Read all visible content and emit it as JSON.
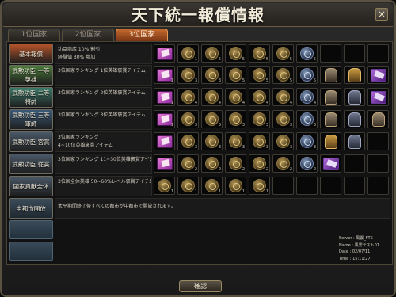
{
  "window": {
    "title": "天下統一報償情報",
    "close_label": "×"
  },
  "tabs": [
    {
      "label": "1位国家",
      "active": false
    },
    {
      "label": "2位国家",
      "active": false
    },
    {
      "label": "3位国家",
      "active": true
    }
  ],
  "rows": [
    {
      "button": "基本報償",
      "button_color": "#b4542a",
      "desc": [
        "功臣商店 10% 割引",
        "経験値 30% 増加"
      ],
      "slots": [
        {
          "icon": "book-icon",
          "count": ""
        },
        {
          "icon": "coin-icon",
          "count": "1"
        },
        {
          "icon": "coin-icon",
          "count": "5"
        },
        {
          "icon": "coin-icon",
          "count": "5"
        },
        {
          "icon": "coin-icon",
          "count": "5"
        },
        {
          "icon": "coin-icon",
          "count": "5"
        },
        {
          "icon": "blue-coin-icon",
          "count": "5"
        }
      ]
    },
    {
      "button": "武勲功臣 一等英雄",
      "button_color": "#4a7a3a",
      "desc": [
        "3位国家ランキング 1位英雄褒賞アイテム"
      ],
      "slots": [
        {
          "icon": "book-icon",
          "count": "1"
        },
        {
          "icon": "coin-icon",
          "count": "3"
        },
        {
          "icon": "coin-icon",
          "count": "3"
        },
        {
          "icon": "coin-icon",
          "count": "5"
        },
        {
          "icon": "coin-icon",
          "count": "5"
        },
        {
          "icon": "coin-icon",
          "count": "5"
        },
        {
          "icon": "blue-coin-icon",
          "count": "5"
        },
        {
          "icon": "armor-icon",
          "count": ""
        },
        {
          "icon": "gold-armor-icon",
          "count": ""
        },
        {
          "icon": "scroll-icon",
          "count": ""
        },
        {
          "icon": "red-helm-icon",
          "count": ""
        }
      ]
    },
    {
      "button": "武勲功臣 二等将帥",
      "button_color": "#3a7a6a",
      "desc": [
        "3位国家ランキング 2位英雄褒賞アイテム"
      ],
      "slots": [
        {
          "icon": "book-icon",
          "count": "1"
        },
        {
          "icon": "coin-icon",
          "count": "4"
        },
        {
          "icon": "coin-icon",
          "count": "4"
        },
        {
          "icon": "coin-icon",
          "count": "4"
        },
        {
          "icon": "coin-icon",
          "count": "4"
        },
        {
          "icon": "coin-icon",
          "count": "4"
        },
        {
          "icon": "blue-coin-icon",
          "count": "4"
        },
        {
          "icon": "armor-icon",
          "count": ""
        },
        {
          "icon": "dark-armor-icon",
          "count": ""
        },
        {
          "icon": "scroll-icon",
          "count": ""
        },
        {
          "icon": "horse-icon",
          "count": ""
        },
        {
          "icon": "dark-helm-icon",
          "count": ""
        }
      ]
    },
    {
      "button": "武勲功臣 三等軍師",
      "button_color": "#3a5a7a",
      "desc": [
        "3位国家ランキング 3位英雄褒賞アイテム"
      ],
      "slots": [
        {
          "icon": "book-icon",
          "count": "1"
        },
        {
          "icon": "coin-icon",
          "count": "3"
        },
        {
          "icon": "coin-icon",
          "count": "3"
        },
        {
          "icon": "coin-icon",
          "count": "3"
        },
        {
          "icon": "coin-icon",
          "count": "3"
        },
        {
          "icon": "coin-icon",
          "count": "3"
        },
        {
          "icon": "blue-coin-icon",
          "count": "3"
        },
        {
          "icon": "armor-icon",
          "count": ""
        },
        {
          "icon": "dark-armor-icon",
          "count": ""
        },
        {
          "icon": "armor-icon",
          "count": ""
        },
        {
          "icon": "scroll-icon",
          "count": ""
        },
        {
          "icon": "dark-helm-icon",
          "count": "11"
        }
      ]
    },
    {
      "button": "武勲功臣 宮賞",
      "button_color": "#4a5868",
      "desc": [
        "3位国家ランキング",
        "4~10位英雄褒賞アイテム"
      ],
      "slots": [
        {
          "icon": "book-icon",
          "count": ""
        },
        {
          "icon": "coin-icon",
          "count": "3"
        },
        {
          "icon": "coin-icon",
          "count": "3"
        },
        {
          "icon": "coin-icon",
          "count": "3"
        },
        {
          "icon": "coin-icon",
          "count": "3"
        },
        {
          "icon": "coin-icon",
          "count": "3"
        },
        {
          "icon": "blue-coin-icon",
          "count": "3"
        },
        {
          "icon": "gold-armor-icon",
          "count": ""
        },
        {
          "icon": "dark-armor-icon",
          "count": ""
        }
      ]
    },
    {
      "button": "武勲功臣 従賞",
      "button_color": "#4a5868",
      "desc": [
        "3位国家ランキング 11~30位英雄褒賞アイテ"
      ],
      "slots": [
        {
          "icon": "book-icon",
          "count": ""
        },
        {
          "icon": "coin-icon",
          "count": "2"
        },
        {
          "icon": "coin-icon",
          "count": "2"
        },
        {
          "icon": "coin-icon",
          "count": "2"
        },
        {
          "icon": "coin-icon",
          "count": "2"
        },
        {
          "icon": "coin-icon",
          "count": "2"
        },
        {
          "icon": "blue-coin-icon",
          "count": "2"
        },
        {
          "icon": "scroll-icon",
          "count": ""
        }
      ]
    },
    {
      "button": "国家貢献全体",
      "button_color": "#4a5868",
      "desc": [
        "3位国全体英雄 50~60%レベル褒賞アイテム"
      ],
      "slots": [
        {
          "icon": "coin-icon",
          "count": "1"
        },
        {
          "icon": "coin-icon",
          "count": "1"
        },
        {
          "icon": "coin-icon",
          "count": "1"
        },
        {
          "icon": "coin-icon",
          "count": "1"
        },
        {
          "icon": "coin-icon",
          "count": "1"
        }
      ]
    }
  ],
  "city_row": {
    "button": "中都市開放",
    "desc": "太平期間終了後すべての都市が中都市で開放されます。"
  },
  "server_info": {
    "server": "Server : 風雲_FTS",
    "name": "Name : 風雲テスト01",
    "date": "Date : 02/07/11",
    "time": "Time : 15:11:27"
  },
  "confirm_label": "確認"
}
